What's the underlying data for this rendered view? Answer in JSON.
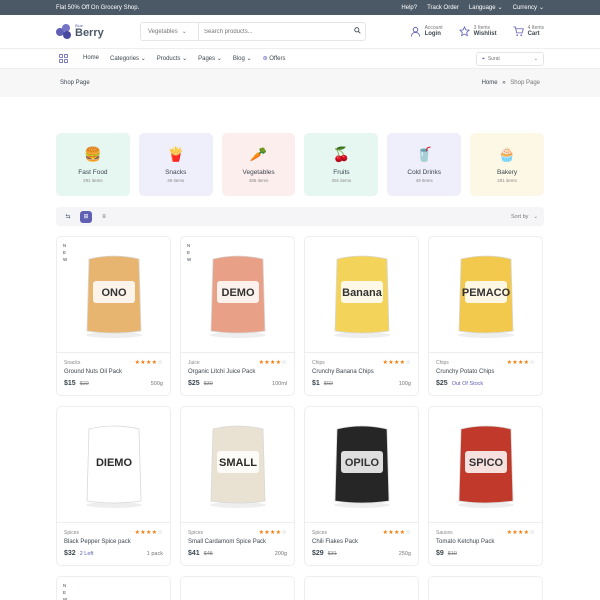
{
  "topbar": {
    "promo": "Flat 50% Off On Grocery Shop.",
    "links": [
      "Help?",
      "Track Order",
      "Language",
      "Currency"
    ]
  },
  "header": {
    "logo_small": "Blue",
    "logo_big": "Berry",
    "search_category": "Vegetables",
    "search_placeholder": "Search products...",
    "account": {
      "line1": "Account",
      "line2": "Login"
    },
    "wishlist": {
      "line1": "3 Items",
      "line2": "Wishlist"
    },
    "cart": {
      "line1": "4 Items",
      "line2": "Cart"
    }
  },
  "nav": {
    "items": [
      "Home",
      "Categories",
      "Products",
      "Pages",
      "Blog",
      "Offers"
    ],
    "location": "Surat"
  },
  "breadcrumb": {
    "title": "Shop Page",
    "home": "Home",
    "separator": "»",
    "current": "Shop Page"
  },
  "categories": [
    {
      "name": "Fast Food",
      "count": "291 items",
      "icon": "burger-icon",
      "glyph": "🍔",
      "bg": "#e6f6f1"
    },
    {
      "name": "Snacks",
      "count": "49 items",
      "icon": "fries-icon",
      "glyph": "🍟",
      "bg": "#efeefb"
    },
    {
      "name": "Vegetables",
      "count": "485 items",
      "icon": "radish-icon",
      "glyph": "🥕",
      "bg": "#fdeeee"
    },
    {
      "name": "Fruits",
      "count": "291 items",
      "icon": "cherry-icon",
      "glyph": "🍒",
      "bg": "#e6f6f1"
    },
    {
      "name": "Cold Drinks",
      "count": "49 items",
      "icon": "drink-icon",
      "glyph": "🥤",
      "bg": "#efeefb"
    },
    {
      "name": "Bakery",
      "count": "291 items",
      "icon": "cupcake-icon",
      "glyph": "🧁",
      "bg": "#fdf8e6"
    }
  ],
  "toolbar": {
    "sort_label": "Sort by"
  },
  "products": [
    {
      "category": "Snacks",
      "name": "Ground Nuts Oil Pack",
      "price": "$15",
      "old": "$22",
      "extra": "",
      "unit": "500g",
      "rating": 4,
      "new": true,
      "pkg": "ONO",
      "pkg_color": "#e8b571",
      "label_color": "#ffffff",
      "icon": "snack-pouch-image"
    },
    {
      "category": "Juice",
      "name": "Organic Litchi Juice Pack",
      "price": "$25",
      "old": "$30",
      "extra": "",
      "unit": "100ml",
      "rating": 4,
      "new": true,
      "pkg": "DEMO",
      "pkg_color": "#e8a086",
      "label_color": "#ffffff",
      "icon": "juice-can-image"
    },
    {
      "category": "Chips",
      "name": "Crunchy Banana Chips",
      "price": "$1",
      "old": "$02",
      "extra": "",
      "unit": "100g",
      "rating": 4,
      "new": false,
      "pkg": "Banana",
      "pkg_color": "#f3d35a",
      "label_color": "#ffffff",
      "icon": "banana-chips-image"
    },
    {
      "category": "Chips",
      "name": "Crunchy Potato Chips",
      "price": "$25",
      "old": "",
      "extra": "Out Of Stock",
      "unit": "",
      "rating": 4,
      "new": false,
      "pkg": "PEMACO",
      "pkg_color": "#f2c94c",
      "label_color": "#ffffff",
      "icon": "potato-chips-image"
    },
    {
      "category": "Spices",
      "name": "Black Pepper Spice pack",
      "price": "$32",
      "old": "",
      "extra": "2 Left",
      "unit": "1 pack",
      "rating": 4,
      "new": false,
      "pkg": "DIEMO",
      "pkg_color": "#ffffff",
      "label_color": "#2b2b2b",
      "icon": "pepper-pack-image"
    },
    {
      "category": "Spices",
      "name": "Small Cardamom Spice Pack",
      "price": "$41",
      "old": "$45",
      "extra": "",
      "unit": "200g",
      "rating": 4,
      "new": false,
      "pkg": "SMALL",
      "pkg_color": "#e9e2d2",
      "label_color": "#3a3a3a",
      "icon": "cardamom-box-image"
    },
    {
      "category": "Spices",
      "name": "Chili Flakes Pack",
      "price": "$29",
      "old": "$31",
      "extra": "",
      "unit": "250g",
      "rating": 4,
      "new": false,
      "pkg": "OPILO",
      "pkg_color": "#262626",
      "label_color": "#ffffff",
      "icon": "chili-flakes-image"
    },
    {
      "category": "Sauces",
      "name": "Tomato Ketchup Pack",
      "price": "$9",
      "old": "$10",
      "extra": "",
      "unit": "",
      "rating": 4,
      "new": false,
      "pkg": "SPICO",
      "pkg_color": "#c0392b",
      "label_color": "#ffffff",
      "icon": "ketchup-pack-image"
    }
  ],
  "partial_products": [
    {
      "new": true
    },
    {
      "new": false
    },
    {
      "new": false
    },
    {
      "new": false
    }
  ],
  "colors": {
    "accent": "#5f5fb3",
    "star": "#f27d0c",
    "topbar": "#4b5966"
  }
}
